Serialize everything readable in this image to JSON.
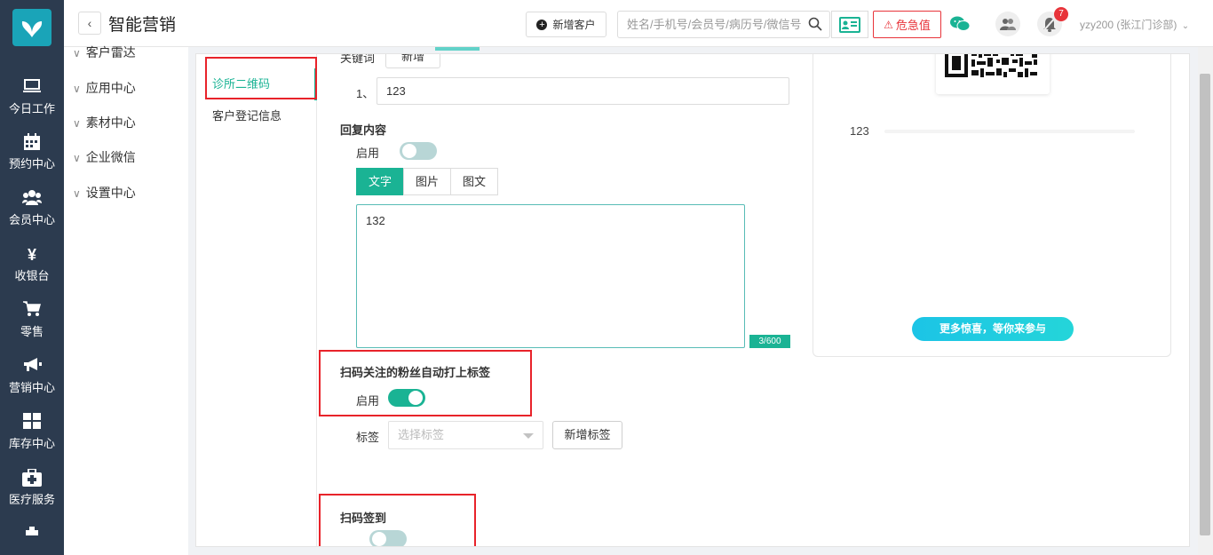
{
  "nav": {
    "items": [
      {
        "label": "今日工作",
        "icon": "monitor-icon"
      },
      {
        "label": "预约中心",
        "icon": "calendar-icon"
      },
      {
        "label": "会员中心",
        "icon": "users-icon"
      },
      {
        "label": "收银台",
        "icon": "yen-icon"
      },
      {
        "label": "零售",
        "icon": "cart-icon"
      },
      {
        "label": "营销中心",
        "icon": "megaphone-icon"
      },
      {
        "label": "库存中心",
        "icon": "grid-icon"
      },
      {
        "label": "医疗服务",
        "icon": "medkit-icon"
      }
    ]
  },
  "header": {
    "title": "智能营销",
    "new_customer": "新增客户",
    "search_placeholder": "姓名/手机号/会员号/病历号/微信号",
    "danger": "危急值",
    "badge_count": "7",
    "user": "yzy200 (张江门诊部)"
  },
  "submenu": {
    "items": [
      {
        "label": "客户雷达"
      },
      {
        "label": "应用中心"
      },
      {
        "label": "素材中心"
      },
      {
        "label": "企业微信"
      },
      {
        "label": "设置中心"
      }
    ]
  },
  "subtabs": {
    "items": [
      {
        "label": "诊所二维码"
      },
      {
        "label": "客户登记信息"
      }
    ]
  },
  "form": {
    "keyword_field_label": "关键词",
    "top_button": "新增",
    "keyword_index": "1、",
    "keyword_value": "123",
    "reply_title": "回复内容",
    "enable_label": "启用",
    "reply_tabs": [
      "文字",
      "图片",
      "图文"
    ],
    "reply_text": "132",
    "counter": "3/600",
    "auto_tag_title": "扫码关注的粉丝自动打上标签",
    "auto_tag_enable_label": "启用",
    "tag_label": "标签",
    "tag_placeholder": "选择标签",
    "add_tag": "新增标签",
    "checkin_title": "扫码签到",
    "reply_enabled": false,
    "auto_tag_enabled": true,
    "checkin_enabled": false
  },
  "preview": {
    "keyword": "123",
    "more_button": "更多惊喜，等你来参与"
  },
  "colors": {
    "nav_bg": "#2c3b4f",
    "accent": "#1ab394",
    "danger": "#e8343a",
    "highlight_box": "#e8232a"
  }
}
